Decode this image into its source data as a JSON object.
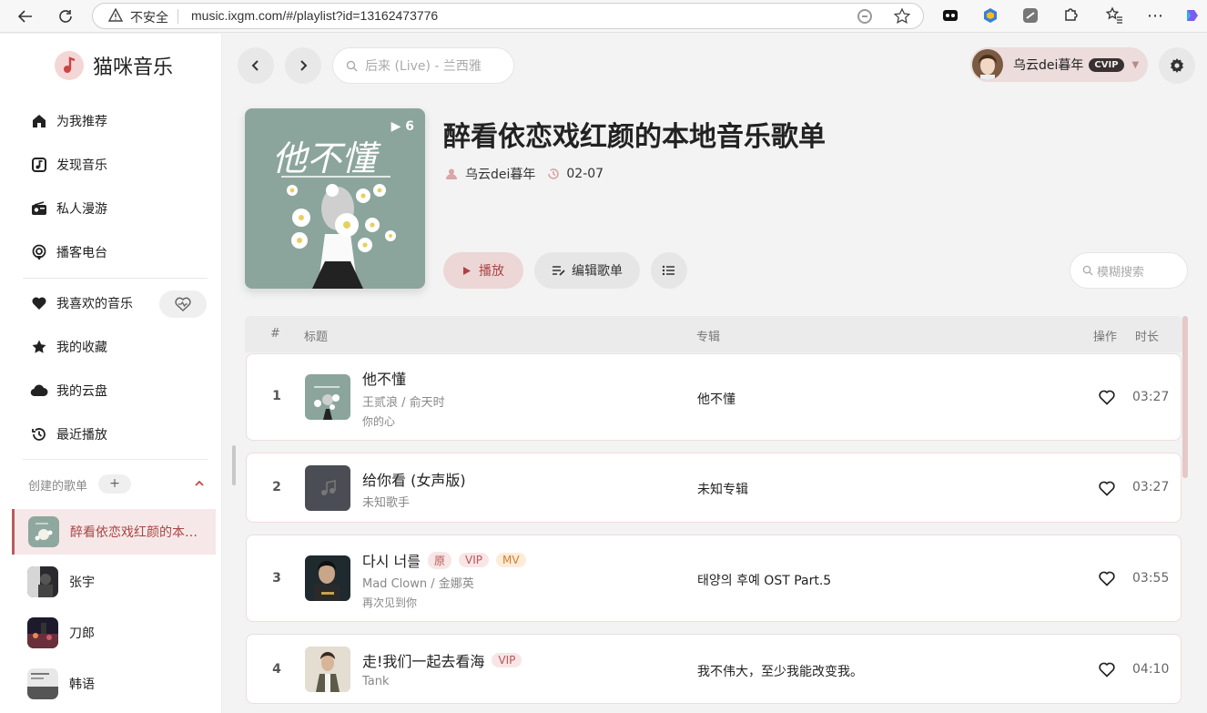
{
  "browser": {
    "insecure_label": "不安全",
    "url": "music.ixgm.com/#/playlist?id=13162473776"
  },
  "sidebar": {
    "app_name": "猫咪音乐",
    "nav": [
      {
        "label": "为我推荐",
        "icon": "home-icon"
      },
      {
        "label": "发现音乐",
        "icon": "music-note-icon"
      },
      {
        "label": "私人漫游",
        "icon": "radio-icon"
      },
      {
        "label": "播客电台",
        "icon": "podcast-icon"
      }
    ],
    "library": [
      {
        "label": "我喜欢的音乐",
        "icon": "heart-icon"
      },
      {
        "label": "我的收藏",
        "icon": "star-icon"
      },
      {
        "label": "我的云盘",
        "icon": "cloud-icon"
      },
      {
        "label": "最近播放",
        "icon": "history-icon"
      }
    ],
    "created_title": "创建的歌单",
    "add_label": "+",
    "playlists": [
      {
        "name": "醉看依恋戏红颜的本地音乐歌单",
        "active": true
      },
      {
        "name": "张宇",
        "active": false
      },
      {
        "name": "刀郎",
        "active": false
      },
      {
        "name": "韩语",
        "active": false
      }
    ]
  },
  "header": {
    "search_placeholder": "后来 (Live) - 兰西雅",
    "username": "乌云dei暮年",
    "vip_badge": "CVIP"
  },
  "playlist": {
    "track_count": "6",
    "cover_text": "他不懂",
    "title": "醉看依恋戏红颜的本地音乐歌单",
    "creator": "乌云dei暮年",
    "date": "02-07",
    "play_label": "播放",
    "edit_label": "编辑歌单",
    "filter_placeholder": "模糊搜索"
  },
  "table": {
    "headers": {
      "index": "#",
      "title": "标题",
      "album": "专辑",
      "actions": "操作",
      "duration": "时长"
    },
    "rows": [
      {
        "index": "1",
        "title": "他不懂",
        "artists": "王贰浪 / 俞天时",
        "alias": "你的心",
        "album": "他不懂",
        "duration": "03:27",
        "tags": []
      },
      {
        "index": "2",
        "title": "给你看 (女声版)",
        "artists": "未知歌手",
        "alias": "",
        "album": "未知专辑",
        "duration": "03:27",
        "tags": []
      },
      {
        "index": "3",
        "title": "다시 너를",
        "artists": "Mad Clown / 金娜英",
        "alias": "再次见到你",
        "album": "태양의 후예 OST Part.5",
        "duration": "03:55",
        "tags": [
          "原",
          "VIP",
          "MV"
        ]
      },
      {
        "index": "4",
        "title": "走!我们一起去看海",
        "artists": "Tank",
        "alias": "",
        "album": "我不伟大，至少我能改变我。",
        "duration": "04:10",
        "tags": [
          "VIP"
        ]
      }
    ]
  },
  "colors": {
    "accent": "#b85c5c",
    "accent_bg": "#edd6d6"
  }
}
